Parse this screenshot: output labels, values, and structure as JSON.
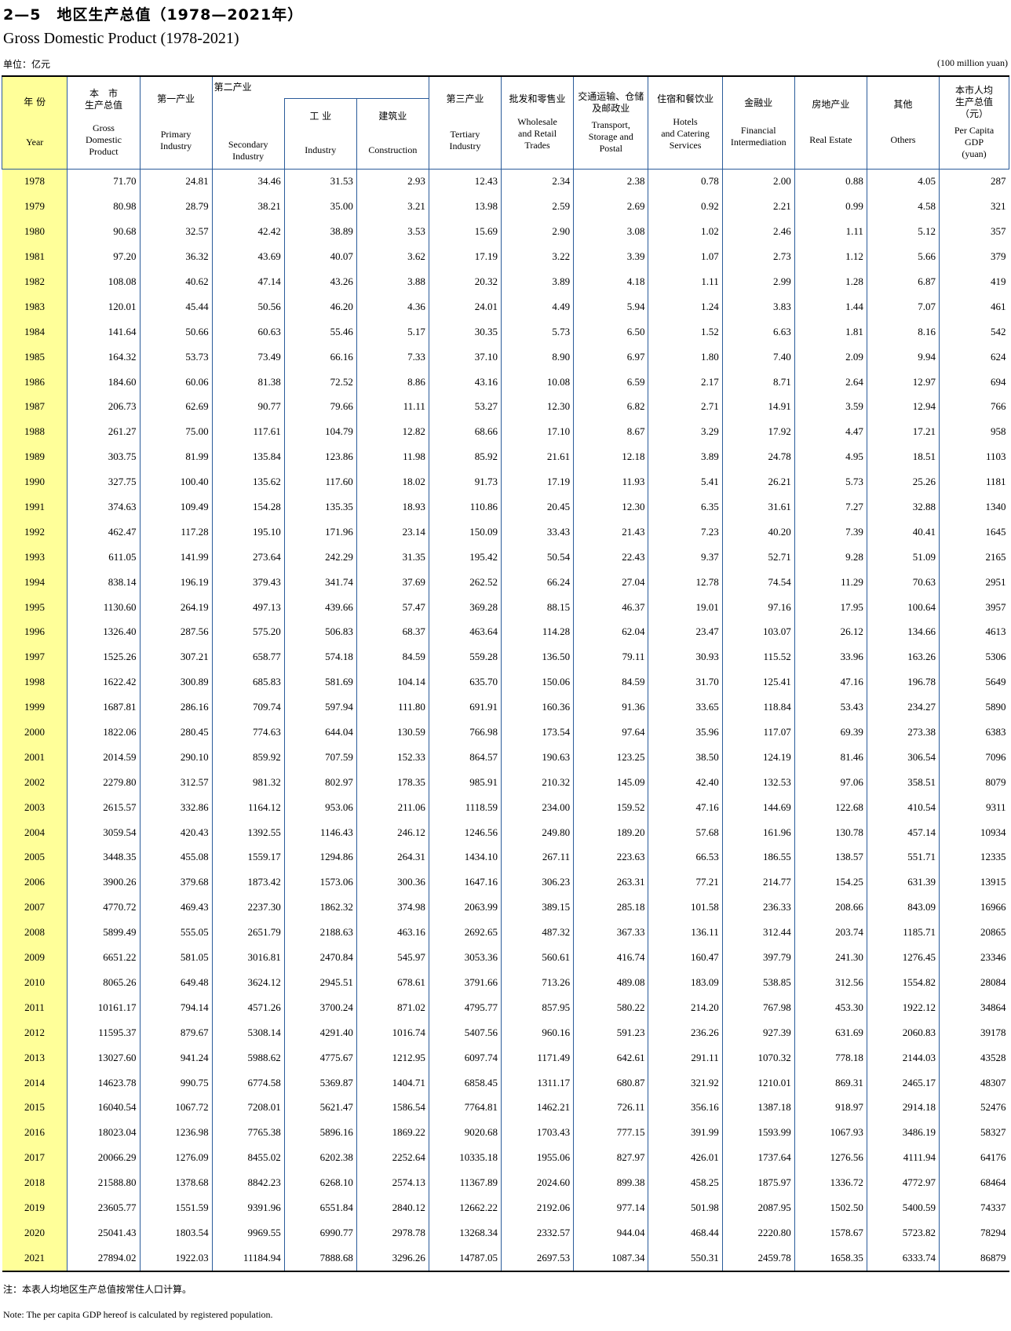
{
  "title": {
    "cn": "2—5　地区生产总值（1978—2021年）",
    "en": "Gross Domestic Product (1978-2021)"
  },
  "unit": {
    "cn": "单位：亿元",
    "en": "(100 million yuan)"
  },
  "headers": {
    "year": {
      "cn": "年 份",
      "en": "Year"
    },
    "gdp": {
      "cn": "本　市\n生产总值",
      "en": "Gross\nDomestic\nProduct"
    },
    "primary": {
      "cn": "第一产业",
      "en": "Primary\nIndustry"
    },
    "secondary": {
      "cn": "第二产业",
      "en": "Secondary\nIndustry"
    },
    "industry": {
      "cn": "工 业",
      "en": "Industry"
    },
    "construction": {
      "cn": "建筑业",
      "en": "Construction"
    },
    "tertiary": {
      "cn": "第三产业",
      "en": "Tertiary\nIndustry"
    },
    "wholesale": {
      "cn": "批发和零售业",
      "en": "Wholesale\nand Retail\nTrades"
    },
    "transport": {
      "cn": "交通运输、仓储\n及邮政业",
      "en": "Transport,\nStorage and\nPostal"
    },
    "hotels": {
      "cn": "住宿和餐饮业",
      "en": "Hotels\nand Catering\nServices"
    },
    "finance": {
      "cn": "金融业",
      "en": "Financial\nIntermediation"
    },
    "realestate": {
      "cn": "房地产业",
      "en": "Real Estate"
    },
    "others": {
      "cn": "其他",
      "en": "Others"
    },
    "percapita": {
      "cn": "本市人均\n生产总值\n（元）",
      "en": "Per Capita\nGDP\n(yuan)"
    }
  },
  "rows": [
    [
      "1978",
      "71.70",
      "24.81",
      "34.46",
      "31.53",
      "2.93",
      "12.43",
      "2.34",
      "2.38",
      "0.78",
      "2.00",
      "0.88",
      "4.05",
      "287"
    ],
    [
      "1979",
      "80.98",
      "28.79",
      "38.21",
      "35.00",
      "3.21",
      "13.98",
      "2.59",
      "2.69",
      "0.92",
      "2.21",
      "0.99",
      "4.58",
      "321"
    ],
    [
      "1980",
      "90.68",
      "32.57",
      "42.42",
      "38.89",
      "3.53",
      "15.69",
      "2.90",
      "3.08",
      "1.02",
      "2.46",
      "1.11",
      "5.12",
      "357"
    ],
    [
      "1981",
      "97.20",
      "36.32",
      "43.69",
      "40.07",
      "3.62",
      "17.19",
      "3.22",
      "3.39",
      "1.07",
      "2.73",
      "1.12",
      "5.66",
      "379"
    ],
    [
      "1982",
      "108.08",
      "40.62",
      "47.14",
      "43.26",
      "3.88",
      "20.32",
      "3.89",
      "4.18",
      "1.11",
      "2.99",
      "1.28",
      "6.87",
      "419"
    ],
    [
      "1983",
      "120.01",
      "45.44",
      "50.56",
      "46.20",
      "4.36",
      "24.01",
      "4.49",
      "5.94",
      "1.24",
      "3.83",
      "1.44",
      "7.07",
      "461"
    ],
    [
      "1984",
      "141.64",
      "50.66",
      "60.63",
      "55.46",
      "5.17",
      "30.35",
      "5.73",
      "6.50",
      "1.52",
      "6.63",
      "1.81",
      "8.16",
      "542"
    ],
    [
      "1985",
      "164.32",
      "53.73",
      "73.49",
      "66.16",
      "7.33",
      "37.10",
      "8.90",
      "6.97",
      "1.80",
      "7.40",
      "2.09",
      "9.94",
      "624"
    ],
    [
      "1986",
      "184.60",
      "60.06",
      "81.38",
      "72.52",
      "8.86",
      "43.16",
      "10.08",
      "6.59",
      "2.17",
      "8.71",
      "2.64",
      "12.97",
      "694"
    ],
    [
      "1987",
      "206.73",
      "62.69",
      "90.77",
      "79.66",
      "11.11",
      "53.27",
      "12.30",
      "6.82",
      "2.71",
      "14.91",
      "3.59",
      "12.94",
      "766"
    ],
    [
      "1988",
      "261.27",
      "75.00",
      "117.61",
      "104.79",
      "12.82",
      "68.66",
      "17.10",
      "8.67",
      "3.29",
      "17.92",
      "4.47",
      "17.21",
      "958"
    ],
    [
      "1989",
      "303.75",
      "81.99",
      "135.84",
      "123.86",
      "11.98",
      "85.92",
      "21.61",
      "12.18",
      "3.89",
      "24.78",
      "4.95",
      "18.51",
      "1103"
    ],
    [
      "1990",
      "327.75",
      "100.40",
      "135.62",
      "117.60",
      "18.02",
      "91.73",
      "17.19",
      "11.93",
      "5.41",
      "26.21",
      "5.73",
      "25.26",
      "1181"
    ],
    [
      "1991",
      "374.63",
      "109.49",
      "154.28",
      "135.35",
      "18.93",
      "110.86",
      "20.45",
      "12.30",
      "6.35",
      "31.61",
      "7.27",
      "32.88",
      "1340"
    ],
    [
      "1992",
      "462.47",
      "117.28",
      "195.10",
      "171.96",
      "23.14",
      "150.09",
      "33.43",
      "21.43",
      "7.23",
      "40.20",
      "7.39",
      "40.41",
      "1645"
    ],
    [
      "1993",
      "611.05",
      "141.99",
      "273.64",
      "242.29",
      "31.35",
      "195.42",
      "50.54",
      "22.43",
      "9.37",
      "52.71",
      "9.28",
      "51.09",
      "2165"
    ],
    [
      "1994",
      "838.14",
      "196.19",
      "379.43",
      "341.74",
      "37.69",
      "262.52",
      "66.24",
      "27.04",
      "12.78",
      "74.54",
      "11.29",
      "70.63",
      "2951"
    ],
    [
      "1995",
      "1130.60",
      "264.19",
      "497.13",
      "439.66",
      "57.47",
      "369.28",
      "88.15",
      "46.37",
      "19.01",
      "97.16",
      "17.95",
      "100.64",
      "3957"
    ],
    [
      "1996",
      "1326.40",
      "287.56",
      "575.20",
      "506.83",
      "68.37",
      "463.64",
      "114.28",
      "62.04",
      "23.47",
      "103.07",
      "26.12",
      "134.66",
      "4613"
    ],
    [
      "1997",
      "1525.26",
      "307.21",
      "658.77",
      "574.18",
      "84.59",
      "559.28",
      "136.50",
      "79.11",
      "30.93",
      "115.52",
      "33.96",
      "163.26",
      "5306"
    ],
    [
      "1998",
      "1622.42",
      "300.89",
      "685.83",
      "581.69",
      "104.14",
      "635.70",
      "150.06",
      "84.59",
      "31.70",
      "125.41",
      "47.16",
      "196.78",
      "5649"
    ],
    [
      "1999",
      "1687.81",
      "286.16",
      "709.74",
      "597.94",
      "111.80",
      "691.91",
      "160.36",
      "91.36",
      "33.65",
      "118.84",
      "53.43",
      "234.27",
      "5890"
    ],
    [
      "2000",
      "1822.06",
      "280.45",
      "774.63",
      "644.04",
      "130.59",
      "766.98",
      "173.54",
      "97.64",
      "35.96",
      "117.07",
      "69.39",
      "273.38",
      "6383"
    ],
    [
      "2001",
      "2014.59",
      "290.10",
      "859.92",
      "707.59",
      "152.33",
      "864.57",
      "190.63",
      "123.25",
      "38.50",
      "124.19",
      "81.46",
      "306.54",
      "7096"
    ],
    [
      "2002",
      "2279.80",
      "312.57",
      "981.32",
      "802.97",
      "178.35",
      "985.91",
      "210.32",
      "145.09",
      "42.40",
      "132.53",
      "97.06",
      "358.51",
      "8079"
    ],
    [
      "2003",
      "2615.57",
      "332.86",
      "1164.12",
      "953.06",
      "211.06",
      "1118.59",
      "234.00",
      "159.52",
      "47.16",
      "144.69",
      "122.68",
      "410.54",
      "9311"
    ],
    [
      "2004",
      "3059.54",
      "420.43",
      "1392.55",
      "1146.43",
      "246.12",
      "1246.56",
      "249.80",
      "189.20",
      "57.68",
      "161.96",
      "130.78",
      "457.14",
      "10934"
    ],
    [
      "2005",
      "3448.35",
      "455.08",
      "1559.17",
      "1294.86",
      "264.31",
      "1434.10",
      "267.11",
      "223.63",
      "66.53",
      "186.55",
      "138.57",
      "551.71",
      "12335"
    ],
    [
      "2006",
      "3900.26",
      "379.68",
      "1873.42",
      "1573.06",
      "300.36",
      "1647.16",
      "306.23",
      "263.31",
      "77.21",
      "214.77",
      "154.25",
      "631.39",
      "13915"
    ],
    [
      "2007",
      "4770.72",
      "469.43",
      "2237.30",
      "1862.32",
      "374.98",
      "2063.99",
      "389.15",
      "285.18",
      "101.58",
      "236.33",
      "208.66",
      "843.09",
      "16966"
    ],
    [
      "2008",
      "5899.49",
      "555.05",
      "2651.79",
      "2188.63",
      "463.16",
      "2692.65",
      "487.32",
      "367.33",
      "136.11",
      "312.44",
      "203.74",
      "1185.71",
      "20865"
    ],
    [
      "2009",
      "6651.22",
      "581.05",
      "3016.81",
      "2470.84",
      "545.97",
      "3053.36",
      "560.61",
      "416.74",
      "160.47",
      "397.79",
      "241.30",
      "1276.45",
      "23346"
    ],
    [
      "2010",
      "8065.26",
      "649.48",
      "3624.12",
      "2945.51",
      "678.61",
      "3791.66",
      "713.26",
      "489.08",
      "183.09",
      "538.85",
      "312.56",
      "1554.82",
      "28084"
    ],
    [
      "2011",
      "10161.17",
      "794.14",
      "4571.26",
      "3700.24",
      "871.02",
      "4795.77",
      "857.95",
      "580.22",
      "214.20",
      "767.98",
      "453.30",
      "1922.12",
      "34864"
    ],
    [
      "2012",
      "11595.37",
      "879.67",
      "5308.14",
      "4291.40",
      "1016.74",
      "5407.56",
      "960.16",
      "591.23",
      "236.26",
      "927.39",
      "631.69",
      "2060.83",
      "39178"
    ],
    [
      "2013",
      "13027.60",
      "941.24",
      "5988.62",
      "4775.67",
      "1212.95",
      "6097.74",
      "1171.49",
      "642.61",
      "291.11",
      "1070.32",
      "778.18",
      "2144.03",
      "43528"
    ],
    [
      "2014",
      "14623.78",
      "990.75",
      "6774.58",
      "5369.87",
      "1404.71",
      "6858.45",
      "1311.17",
      "680.87",
      "321.92",
      "1210.01",
      "869.31",
      "2465.17",
      "48307"
    ],
    [
      "2015",
      "16040.54",
      "1067.72",
      "7208.01",
      "5621.47",
      "1586.54",
      "7764.81",
      "1462.21",
      "726.11",
      "356.16",
      "1387.18",
      "918.97",
      "2914.18",
      "52476"
    ],
    [
      "2016",
      "18023.04",
      "1236.98",
      "7765.38",
      "5896.16",
      "1869.22",
      "9020.68",
      "1703.43",
      "777.15",
      "391.99",
      "1593.99",
      "1067.93",
      "3486.19",
      "58327"
    ],
    [
      "2017",
      "20066.29",
      "1276.09",
      "8455.02",
      "6202.38",
      "2252.64",
      "10335.18",
      "1955.06",
      "827.97",
      "426.01",
      "1737.64",
      "1276.56",
      "4111.94",
      "64176"
    ],
    [
      "2018",
      "21588.80",
      "1378.68",
      "8842.23",
      "6268.10",
      "2574.13",
      "11367.89",
      "2024.60",
      "899.38",
      "458.25",
      "1875.97",
      "1336.72",
      "4772.97",
      "68464"
    ],
    [
      "2019",
      "23605.77",
      "1551.59",
      "9391.96",
      "6551.84",
      "2840.12",
      "12662.22",
      "2192.06",
      "977.14",
      "501.98",
      "2087.95",
      "1502.50",
      "5400.59",
      "74337"
    ],
    [
      "2020",
      "25041.43",
      "1803.54",
      "9969.55",
      "6990.77",
      "2978.78",
      "13268.34",
      "2332.57",
      "944.04",
      "468.44",
      "2220.80",
      "1578.67",
      "5723.82",
      "78294"
    ],
    [
      "2021",
      "27894.02",
      "1922.03",
      "11184.94",
      "7888.68",
      "3296.26",
      "14787.05",
      "2697.53",
      "1087.34",
      "550.31",
      "2459.78",
      "1658.35",
      "6333.74",
      "86879"
    ]
  ],
  "notes": {
    "cn": "注：本表人均地区生产总值按常住人口计算。",
    "en": "Note: The per capita GDP hereof is calculated by registered population."
  }
}
